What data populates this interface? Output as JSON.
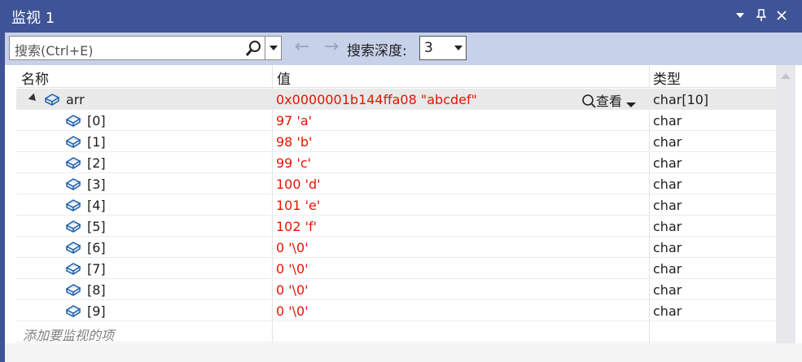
{
  "window": {
    "title": "监视 1"
  },
  "toolbar": {
    "search_placeholder": "搜索(Ctrl+E)",
    "depth_label": "搜索深度:",
    "depth_value": "3"
  },
  "columns": {
    "name": "名称",
    "value": "值",
    "type": "类型"
  },
  "root": {
    "name": "arr",
    "value": "0x0000001b144ffa08 \"abcdef\"",
    "viewer": "查看",
    "type": "char[10]"
  },
  "items": [
    {
      "name": "[0]",
      "value": "97 'a'",
      "type": "char"
    },
    {
      "name": "[1]",
      "value": "98 'b'",
      "type": "char"
    },
    {
      "name": "[2]",
      "value": "99 'c'",
      "type": "char"
    },
    {
      "name": "[3]",
      "value": "100 'd'",
      "type": "char"
    },
    {
      "name": "[4]",
      "value": "101 'e'",
      "type": "char"
    },
    {
      "name": "[5]",
      "value": "102 'f'",
      "type": "char"
    },
    {
      "name": "[6]",
      "value": "0 '\\0'",
      "type": "char"
    },
    {
      "name": "[7]",
      "value": "0 '\\0'",
      "type": "char"
    },
    {
      "name": "[8]",
      "value": "0 '\\0'",
      "type": "char"
    },
    {
      "name": "[9]",
      "value": "0 '\\0'",
      "type": "char"
    }
  ],
  "add_watch": "添加要监视的项",
  "colors": {
    "title_bar": "#3f5496",
    "toolbar": "#c8d1ea",
    "value_text": "#e51400"
  },
  "icons": [
    "chevron-down-icon",
    "pin-icon",
    "close-icon",
    "search-icon",
    "back-arrow-icon",
    "forward-arrow-icon",
    "variable-icon",
    "magnifier-icon"
  ]
}
